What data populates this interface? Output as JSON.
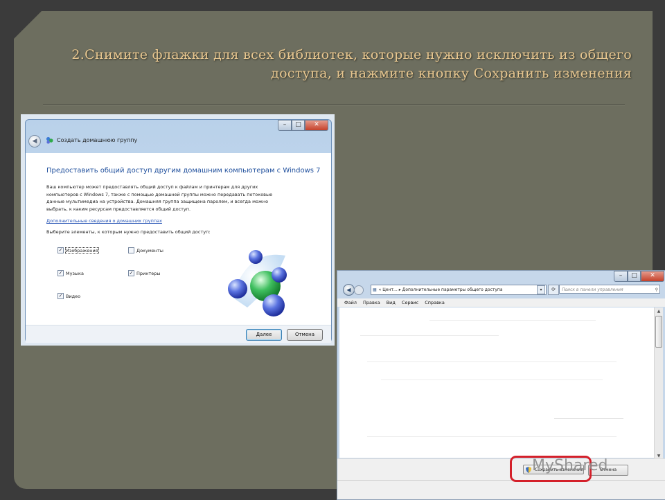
{
  "slide": {
    "title_number": "2.",
    "title_text": "Снимите флажки для всех библиотек, которые нужно исключить из общего доступа, и нажмите кнопку Сохранить изменения"
  },
  "dialog1": {
    "header_title": "Создать домашнюю группу",
    "heading": "Предоставить общий доступ другим домашним компьютерам с Windows 7",
    "paragraph": "Ваш компьютер может предоставлять общий доступ к файлам и принтерам для других компьютеров с Windows 7, также с помощью домашней группы можно передавать потоковые данные мультимедиа на устройства. Домашняя группа защищена паролем, и всегда можно выбрать, к каким ресурсам предоставляется общий доступ.",
    "more_link": "Дополнительные сведения о домашних группах",
    "choose_text": "Выберите элементы, к которым нужно предоставить общий доступ:",
    "checkboxes": [
      {
        "label": "Изображения",
        "checked": true
      },
      {
        "label": "Документы",
        "checked": false
      },
      {
        "label": "Музыка",
        "checked": true
      },
      {
        "label": "Принтеры",
        "checked": true
      },
      {
        "label": "Видео",
        "checked": true
      }
    ],
    "next_button": "Далее",
    "cancel_button": "Отмена"
  },
  "window2": {
    "address_prefix": "«",
    "address_part1": "Цент...",
    "address_separator": "▸",
    "address_part2": "Дополнительные параметры общего доступа",
    "search_placeholder": "Поиск в панели управления",
    "menu": [
      "Файл",
      "Правка",
      "Вид",
      "Сервис",
      "Справка"
    ],
    "save_button": "Сохранить изменения",
    "cancel_button": "Отмена"
  },
  "watermark": "MyShared",
  "colors": {
    "slide_background": "#6d6e5f",
    "title_color": "#e8c790",
    "highlight": "#d4202a",
    "link": "#2553b5",
    "heading_blue": "#1e4e9c"
  }
}
